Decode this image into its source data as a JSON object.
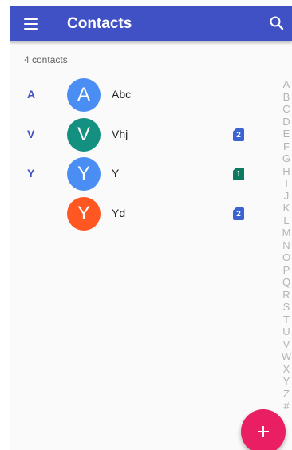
{
  "app_bar": {
    "title": "Contacts",
    "menu_icon": "hamburger-menu-icon",
    "search_icon": "search-icon",
    "color": "#3f51c4"
  },
  "contact_count": "4 contacts",
  "contacts": [
    {
      "section": "A",
      "initial": "A",
      "name": "Abc",
      "avatar_color": "#4a8ef4",
      "sim": ""
    },
    {
      "section": "V",
      "initial": "V",
      "name": "Vhj",
      "avatar_color": "#139080",
      "sim": "2",
      "sim_color": "#3b63d1"
    },
    {
      "section": "Y",
      "initial": "Y",
      "name": "Y",
      "avatar_color": "#4a8ef4",
      "sim": "1",
      "sim_color": "#0d7a5f"
    },
    {
      "section": "",
      "initial": "Y",
      "name": "Yd",
      "avatar_color": "#ff5722",
      "sim": "2",
      "sim_color": "#3b63d1"
    }
  ],
  "index_letters": [
    "A",
    "B",
    "C",
    "D",
    "E",
    "F",
    "G",
    "H",
    "I",
    "J",
    "K",
    "L",
    "M",
    "N",
    "O",
    "P",
    "Q",
    "R",
    "S",
    "T",
    "U",
    "V",
    "W",
    "X",
    "Y",
    "Z",
    "#"
  ],
  "fab": {
    "icon": "plus-icon",
    "color": "#e91e63"
  }
}
